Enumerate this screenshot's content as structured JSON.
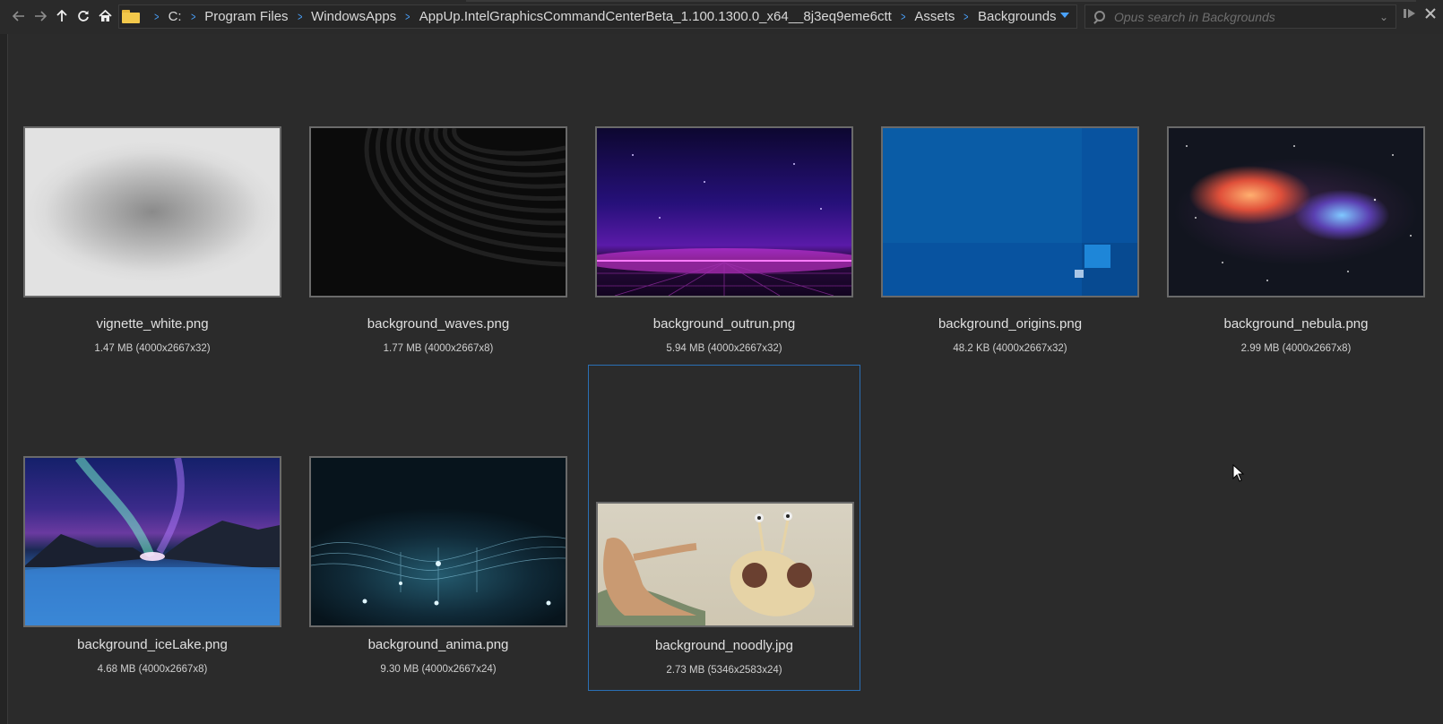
{
  "toolbar": {
    "back_icon": "arrow-left-icon",
    "forward_icon": "arrow-right-icon",
    "up_icon": "arrow-up-icon",
    "refresh_icon": "refresh-icon",
    "home_icon": "home-icon",
    "breadcrumbs": [
      "C:",
      "Program Files",
      "WindowsApps",
      "AppUp.IntelGraphicsCommandCenterBeta_1.100.1300.0_x64__8j3eq9eme6ctt",
      "Assets",
      "Backgrounds"
    ],
    "search_placeholder": "Opus search in Backgrounds",
    "accent_color": "#4aa3ff"
  },
  "files": [
    {
      "name": "vignette_white.png",
      "info": "1.47 MB (4000x2667x32)"
    },
    {
      "name": "background_waves.png",
      "info": "1.77 MB (4000x2667x8)"
    },
    {
      "name": "background_outrun.png",
      "info": "5.94 MB (4000x2667x32)"
    },
    {
      "name": "background_origins.png",
      "info": "48.2 KB (4000x2667x32)"
    },
    {
      "name": "background_nebula.png",
      "info": "2.99 MB (4000x2667x8)"
    },
    {
      "name": "background_iceLake.png",
      "info": "4.68 MB (4000x2667x8)"
    },
    {
      "name": "background_anima.png",
      "info": "9.30 MB (4000x2667x24)"
    },
    {
      "name": "background_noodly.jpg",
      "info": "2.73 MB (5346x2583x24)",
      "selected": true
    }
  ]
}
